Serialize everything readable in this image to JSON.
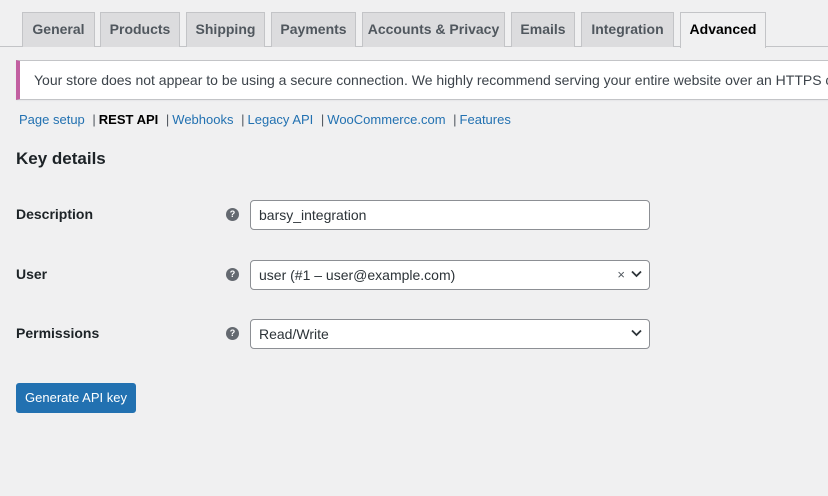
{
  "tabs": [
    {
      "label": "General"
    },
    {
      "label": "Products"
    },
    {
      "label": "Shipping"
    },
    {
      "label": "Payments"
    },
    {
      "label": "Accounts & Privacy"
    },
    {
      "label": "Emails"
    },
    {
      "label": "Integration"
    },
    {
      "label": "Advanced",
      "active": true
    }
  ],
  "notice": {
    "text": "Your store does not appear to be using a secure connection. We highly recommend serving your entire website over an HTTPS connection"
  },
  "subnav": {
    "items": [
      "Page setup",
      "REST API",
      "Webhooks",
      "Legacy API",
      "WooCommerce.com",
      "Features"
    ],
    "current": "REST API",
    "separator": "|"
  },
  "heading": "Key details",
  "form": {
    "description": {
      "label": "Description",
      "value": "barsy_integration"
    },
    "user": {
      "label": "User",
      "value": "user (#1 – user@example.com)",
      "clear": "×"
    },
    "permissions": {
      "label": "Permissions",
      "value": "Read/Write"
    },
    "help_glyph": "?"
  },
  "button": {
    "label": "Generate API key"
  },
  "colors": {
    "background": "#f0f0f1",
    "accent": "#2271b1",
    "notice_border": "#c25fa1",
    "tab_inactive": "#dcdcde"
  }
}
